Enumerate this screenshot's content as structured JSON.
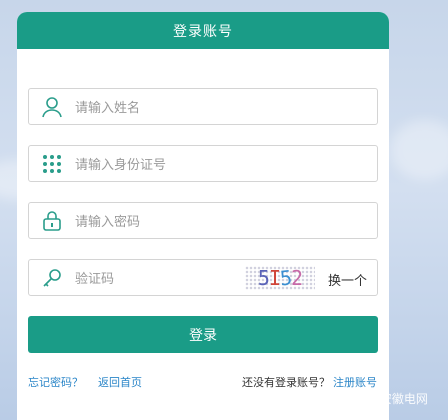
{
  "header": {
    "title": "登录账号"
  },
  "fields": {
    "name_placeholder": "请输入姓名",
    "id_placeholder": "请输入身份证号",
    "password_placeholder": "请输入密码",
    "captcha_placeholder": "验证码"
  },
  "captcha": {
    "chars": [
      "5",
      "I",
      "5",
      "2"
    ],
    "refresh_label": "换一个"
  },
  "login_label": "登录",
  "links": {
    "forgot": "忘记密码？",
    "home": "返回首页",
    "no_account": "还没有登录账号？",
    "register": "注册账号"
  },
  "watermark": "知乎 @宏湃安徽电网",
  "colors": {
    "accent": "#1a9c87",
    "link": "#2b86c8"
  },
  "icons": [
    "user-icon",
    "keypad-icon",
    "lock-icon",
    "key-icon"
  ]
}
